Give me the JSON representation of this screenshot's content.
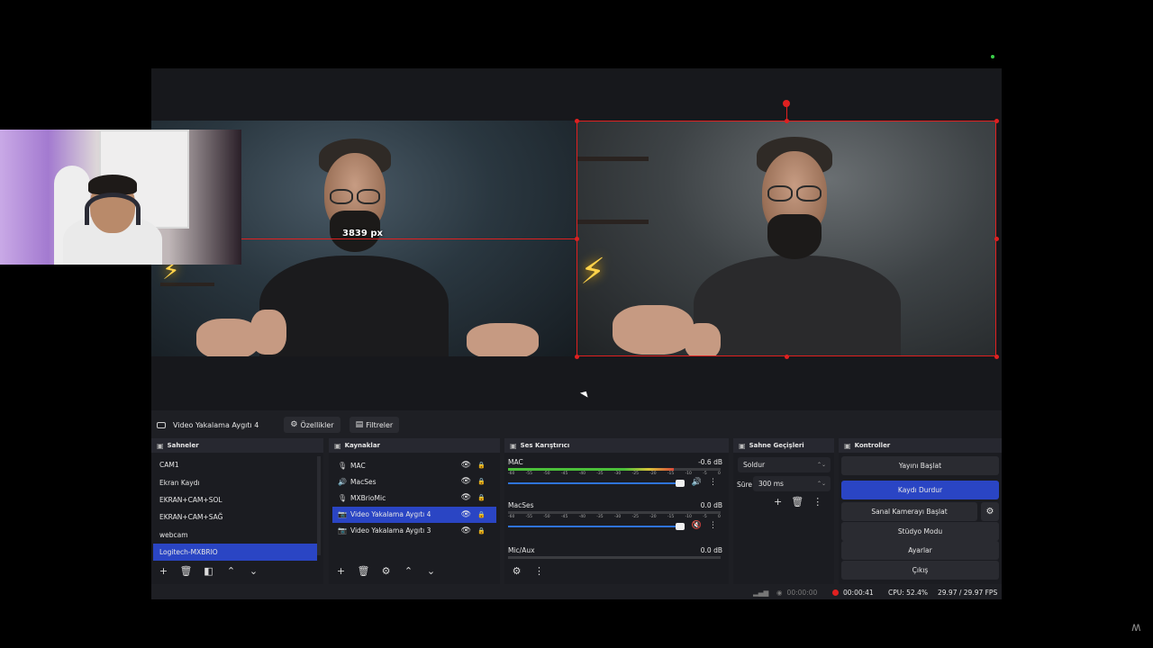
{
  "preview": {
    "measure_label": "3839 px"
  },
  "toolbar": {
    "selected_source": "Video Yakalama Aygıtı 4",
    "properties_label": "Özellikler",
    "filters_label": "Filtreler"
  },
  "scenes": {
    "title": "Sahneler",
    "items": [
      "CAM1",
      "Ekran Kaydı",
      "EKRAN+CAM+SOL",
      "EKRAN+CAM+SAĞ",
      "webcam",
      "Logitech-MXBRIO"
    ],
    "selected_index": 5
  },
  "sources": {
    "title": "Kaynaklar",
    "items": [
      {
        "label": "MAC",
        "icon": "mic-icon"
      },
      {
        "label": "MacSes",
        "icon": "speaker-icon"
      },
      {
        "label": "MXBrioMic",
        "icon": "mic-icon"
      },
      {
        "label": "Video Yakalama Aygıtı 4",
        "icon": "camera-icon"
      },
      {
        "label": "Video Yakalama Aygıtı 3",
        "icon": "camera-icon"
      }
    ],
    "selected_index": 3
  },
  "mixer": {
    "title": "Ses Karıştırıcı",
    "ticks": [
      "-60",
      "-55",
      "-50",
      "-45",
      "-40",
      "-35",
      "-30",
      "-25",
      "-20",
      "-15",
      "-10",
      "-5",
      "0"
    ],
    "channels": [
      {
        "name": "MAC",
        "db": "-0.6 dB",
        "level": 0.78
      },
      {
        "name": "MacSes",
        "db": "0.0 dB",
        "level": 0.0
      },
      {
        "name": "Mic/Aux",
        "db": "0.0 dB",
        "level": 0.0
      }
    ]
  },
  "transitions": {
    "title": "Sahne Geçişleri",
    "selected": "Soldur",
    "duration_label": "Süre",
    "duration_value": "300 ms"
  },
  "controls": {
    "title": "Kontroller",
    "start_stream": "Yayını Başlat",
    "stop_recording": "Kaydı Durdur",
    "virtual_camera": "Sanal Kamerayı Başlat",
    "studio_mode": "Stüdyo Modu",
    "settings": "Ayarlar",
    "exit": "Çıkış"
  },
  "status": {
    "stream_time": "00:00:00",
    "rec_time": "00:00:41",
    "cpu": "CPU: 52.4%",
    "fps": "29.97 / 29.97 FPS"
  },
  "colors": {
    "accent": "#2a45c4",
    "selection": "#e02020",
    "recording": "#e02020"
  }
}
